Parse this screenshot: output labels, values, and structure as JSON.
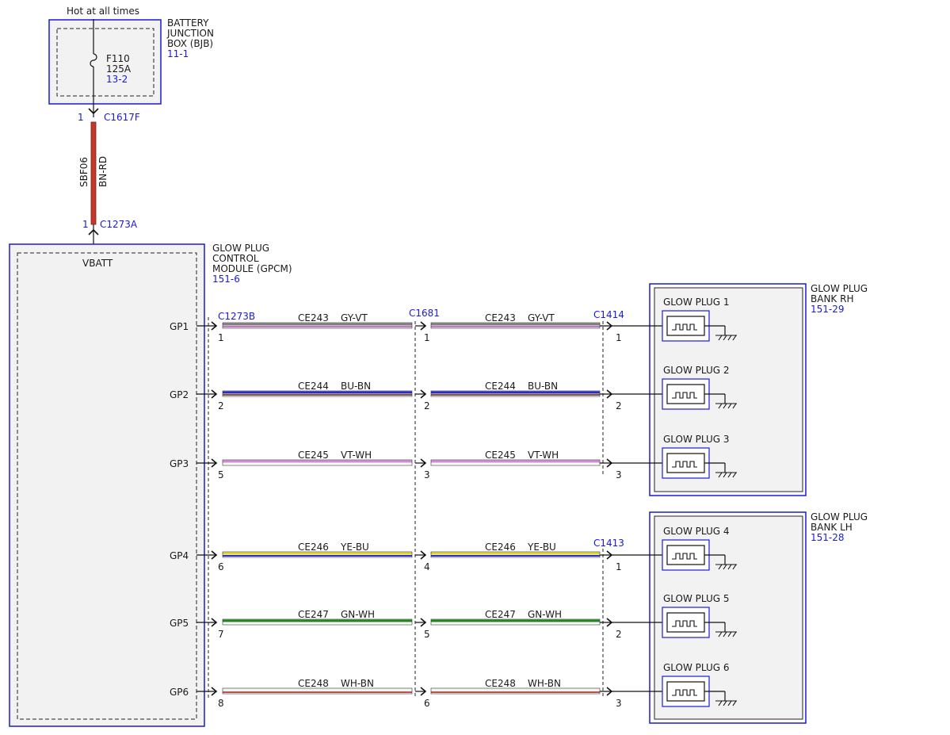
{
  "header": {
    "hot_label": "Hot at all times"
  },
  "bjb": {
    "name_lines": [
      "BATTERY",
      "JUNCTION",
      "BOX (BJB)"
    ],
    "ref": "11-1",
    "fuse": {
      "id": "F110",
      "rating": "125A",
      "ref": "13-2"
    },
    "connector": {
      "pin": "1",
      "id": "C1617F"
    }
  },
  "feed_wire": {
    "circuit": "SBF06",
    "color_code": "BN-RD",
    "color": "#c0392b"
  },
  "gpcm": {
    "name_lines": [
      "GLOW PLUG",
      "CONTROL",
      "MODULE (GPCM)"
    ],
    "ref": "151-6",
    "input_label": "VBATT",
    "input_connector": {
      "pin": "1",
      "id": "C1273A"
    },
    "output_connector": "C1273B"
  },
  "inline_connector": "C1681",
  "rows": [
    {
      "gp": "GP1",
      "circuit": "CE243",
      "color_code": "GY-VT",
      "pin_a": "1",
      "pin_b": "1",
      "pin_c": "1",
      "plug": "GLOW PLUG 1",
      "colors": [
        "#808080",
        "#c875c4"
      ]
    },
    {
      "gp": "GP2",
      "circuit": "CE244",
      "color_code": "BU-BN",
      "pin_a": "2",
      "pin_b": "2",
      "pin_c": "2",
      "plug": "GLOW PLUG 2",
      "colors": [
        "#2a2ad0",
        "#8b5a2b"
      ]
    },
    {
      "gp": "GP3",
      "circuit": "CE245",
      "color_code": "VT-WH",
      "pin_a": "5",
      "pin_b": "3",
      "pin_c": "3",
      "plug": "GLOW PLUG 3",
      "colors": [
        "#d58ad8",
        "#ffffff"
      ]
    },
    {
      "gp": "GP4",
      "circuit": "CE246",
      "color_code": "YE-BU",
      "pin_a": "6",
      "pin_b": "4",
      "pin_c": "1",
      "plug": "GLOW PLUG 4",
      "colors": [
        "#e6d62a",
        "#2a2ad0"
      ]
    },
    {
      "gp": "GP5",
      "circuit": "CE247",
      "color_code": "GN-WH",
      "pin_a": "7",
      "pin_b": "5",
      "pin_c": "2",
      "plug": "GLOW PLUG 5",
      "colors": [
        "#1f8a1f",
        "#ffffff"
      ]
    },
    {
      "gp": "GP6",
      "circuit": "CE248",
      "color_code": "WH-BN",
      "pin_a": "8",
      "pin_b": "6",
      "pin_c": "3",
      "plug": "GLOW PLUG 6",
      "colors": [
        "#f2f2f2",
        "#b5564a"
      ]
    }
  ],
  "banks": [
    {
      "name_lines": [
        "GLOW PLUG",
        "BANK RH"
      ],
      "ref": "151-29",
      "connector": "C1414"
    },
    {
      "name_lines": [
        "GLOW PLUG",
        "BANK LH"
      ],
      "ref": "151-28",
      "connector": "C1413"
    }
  ],
  "colors": {
    "ref_text": "#1a1ad6",
    "component_border": "#1a1ad6",
    "box_fill": "#f2f2f2"
  }
}
